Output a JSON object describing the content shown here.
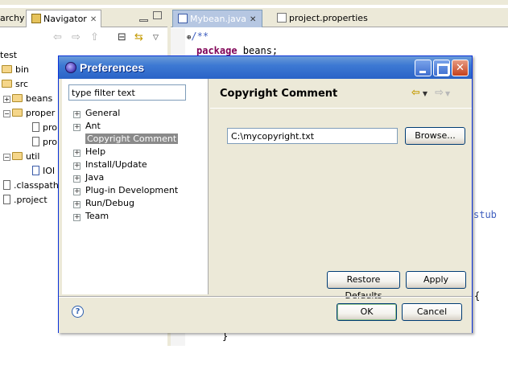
{
  "ide": {
    "navigator_tabs": [
      {
        "label": "archy"
      },
      {
        "label": "Navigator"
      }
    ],
    "navigator_tree": [
      {
        "label": "test"
      },
      {
        "label": "bin"
      },
      {
        "label": "src"
      },
      {
        "label": "beans"
      },
      {
        "label": "proper"
      },
      {
        "label": "pro"
      },
      {
        "label": "pro"
      },
      {
        "label": "util"
      },
      {
        "label": "IOI"
      },
      {
        "label": ".classpath"
      },
      {
        "label": ".project"
      }
    ],
    "editor_tabs": [
      {
        "label": "Mybean.java"
      },
      {
        "label": "project.properties"
      }
    ],
    "code": {
      "line1": "/**",
      "line2_kw": "package",
      "line2_rest": " beans;",
      "stub_fragment": "stub",
      "brace_open": "{",
      "brace_close": "}"
    }
  },
  "dialog": {
    "title": "Preferences",
    "filter_placeholder": "type filter text",
    "tree": [
      {
        "label": "General",
        "expandable": true
      },
      {
        "label": "Ant",
        "expandable": true
      },
      {
        "label": "Copyright Comment",
        "expandable": false,
        "selected": true
      },
      {
        "label": "Help",
        "expandable": true
      },
      {
        "label": "Install/Update",
        "expandable": true
      },
      {
        "label": "Java",
        "expandable": true
      },
      {
        "label": "Plug-in Development",
        "expandable": true
      },
      {
        "label": "Run/Debug",
        "expandable": true
      },
      {
        "label": "Team",
        "expandable": true
      }
    ],
    "page_title": "Copyright Comment",
    "file_path": "C:\\mycopyright.txt",
    "buttons": {
      "browse": "Browse...",
      "restore_defaults": "Restore Defaults",
      "apply": "Apply",
      "ok": "OK",
      "cancel": "Cancel"
    },
    "help_glyph": "?"
  }
}
